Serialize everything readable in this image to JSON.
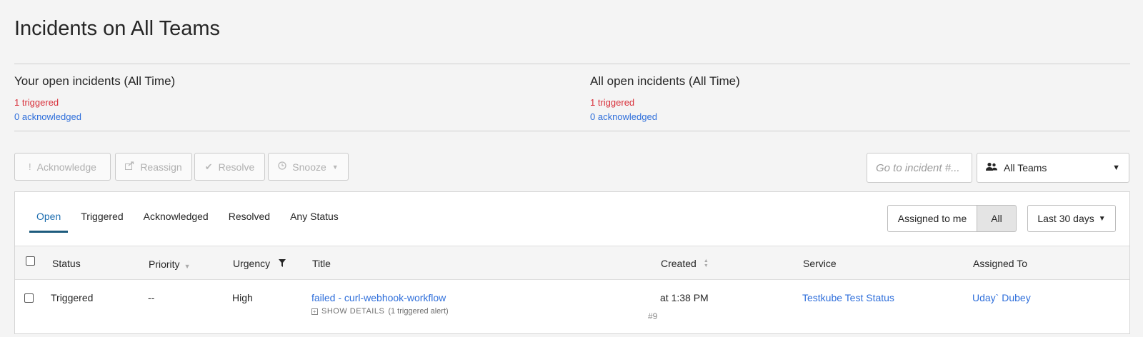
{
  "page": {
    "title": "Incidents on All Teams"
  },
  "summary": {
    "yours": {
      "heading": "Your open incidents (All Time)",
      "triggered": "1 triggered",
      "acknowledged": "0 acknowledged"
    },
    "all": {
      "heading": "All open incidents (All Time)",
      "triggered": "1 triggered",
      "acknowledged": "0 acknowledged"
    }
  },
  "toolbar": {
    "acknowledge": "Acknowledge",
    "reassign": "Reassign",
    "resolve": "Resolve",
    "snooze": "Snooze",
    "goto_placeholder": "Go to incident #...",
    "team_select": "All Teams"
  },
  "tabs": [
    "Open",
    "Triggered",
    "Acknowledged",
    "Resolved",
    "Any Status"
  ],
  "filters": {
    "assigned_to_me": "Assigned to me",
    "all": "All",
    "date_range": "Last 30 days"
  },
  "table": {
    "headers": {
      "status": "Status",
      "priority": "Priority",
      "urgency": "Urgency",
      "title": "Title",
      "created": "Created",
      "service": "Service",
      "assigned_to": "Assigned To"
    },
    "rows": [
      {
        "status": "Triggered",
        "priority": "--",
        "urgency": "High",
        "title": "failed - curl-webhook-workflow",
        "show_details": "SHOW DETAILS",
        "alert_count": "(1 triggered alert)",
        "number": "#9",
        "created": "at 1:38 PM",
        "service": "Testkube Test Status",
        "assigned_to": "Uday` Dubey"
      }
    ]
  },
  "colors": {
    "triggered": "#d8313b",
    "link": "#2f6fdb",
    "tab_active_underline": "#1d5b7d"
  }
}
